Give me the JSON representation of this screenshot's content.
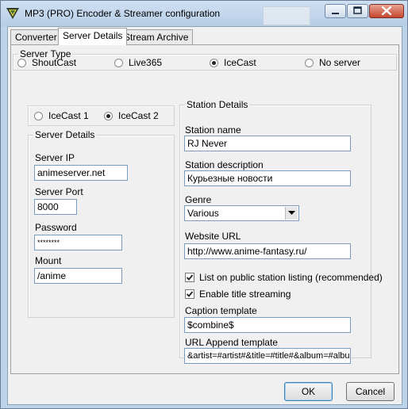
{
  "window": {
    "title": "MP3 (PRO) Encoder & Streamer configuration",
    "title_controls": [
      "minimize-icon",
      "maximize-icon",
      "close-icon"
    ]
  },
  "tabs": [
    {
      "label": "Converter",
      "active": false
    },
    {
      "label": "Server Details",
      "active": true
    },
    {
      "label": "Stream Archive",
      "active": false
    }
  ],
  "server_type": {
    "legend": "Server Type",
    "options": [
      {
        "label": "ShoutCast",
        "selected": false
      },
      {
        "label": "Live365",
        "selected": false
      },
      {
        "label": "IceCast",
        "selected": true
      },
      {
        "label": "No server",
        "selected": false
      }
    ]
  },
  "icecast_version": {
    "options": [
      {
        "label": "IceCast 1",
        "selected": false
      },
      {
        "label": "IceCast 2",
        "selected": true
      }
    ]
  },
  "server_details": {
    "legend": "Server Details",
    "server_ip_label": "Server IP",
    "server_ip_value": "animeserver.net",
    "server_port_label": "Server Port",
    "server_port_value": "8000",
    "password_label": "Password",
    "password_value": "********",
    "mount_label": "Mount",
    "mount_value": "/anime"
  },
  "station_details": {
    "legend": "Station Details",
    "station_name_label": "Station name",
    "station_name_value": "RJ Never",
    "station_description_label": "Station description",
    "station_description_value": "Курьезные новости",
    "genre_label": "Genre",
    "genre_value": "Various",
    "website_url_label": "Website URL",
    "website_url_value": "http://www.anime-fantasy.ru/",
    "list_public_label": "List on public station listing (recommended)",
    "list_public_checked": true,
    "enable_title_label": "Enable title streaming",
    "enable_title_checked": true,
    "caption_template_label": "Caption template",
    "caption_template_value": "$combine$",
    "url_append_label": "URL Append template",
    "url_append_value": "&artist=#artist#&title=#title#&album=#album#"
  },
  "buttons": {
    "ok": "OK",
    "cancel": "Cancel"
  },
  "colors": {
    "frame": "#bcd3ea",
    "client_bg": "#f0f0f0",
    "input_border": "#7a9cc0",
    "close_button": "#c4452e"
  }
}
